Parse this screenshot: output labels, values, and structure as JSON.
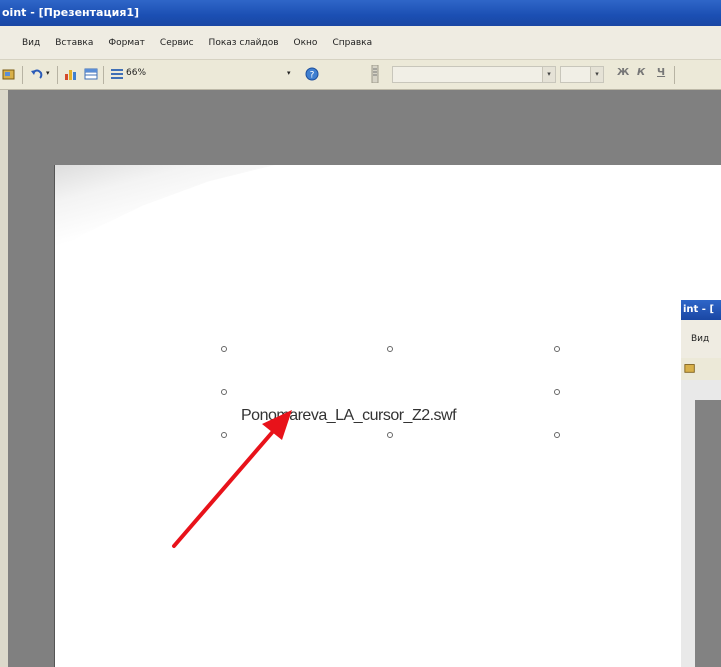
{
  "window": {
    "title": "oint - [Презентация1]"
  },
  "menu": {
    "items": [
      "Вид",
      "Вставка",
      "Формат",
      "Сервис",
      "Показ слайдов",
      "Окно",
      "Справка"
    ]
  },
  "toolbar": {
    "zoom_value": "66%",
    "font_style_labels": [
      "Ж",
      "К",
      "Ч"
    ]
  },
  "slide": {
    "object_label": "Ponomareva_LA_cursor_Z2.swf"
  },
  "second_window": {
    "title": "int - [",
    "menu_item": "Вид"
  },
  "colors": {
    "titlebar": "#1b4fb3",
    "menubar": "#efece2",
    "workarea": "#808080",
    "arrow": "#e8121a"
  }
}
